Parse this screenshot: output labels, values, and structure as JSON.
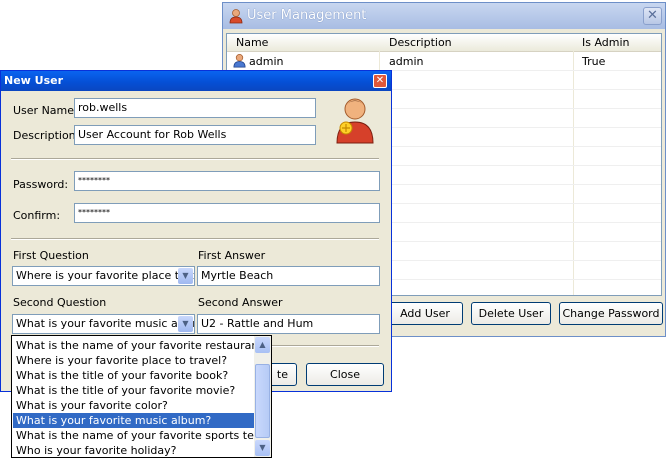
{
  "user_management": {
    "title": "User Management",
    "columns": [
      "Name",
      "Description",
      "Is Admin"
    ],
    "rows": [
      {
        "name": "admin",
        "description": "admin",
        "is_admin": "True"
      }
    ],
    "buttons": {
      "add_user": "Add User",
      "delete_user": "Delete User",
      "change_password": "Change Password"
    }
  },
  "new_user": {
    "title": "New User",
    "close_glyph": "✕",
    "user_name_label": "User Name:",
    "user_name_value": "rob.wells",
    "description_label": "Description:",
    "description_value": "User Account for Rob Wells",
    "password_label": "Password:",
    "password_value": "********",
    "confirm_label": "Confirm:",
    "confirm_value": "********",
    "first_question_label": "First Question",
    "first_question_value": "Where is your favorite place to tra",
    "first_answer_label": "First Answer",
    "first_answer_value": "Myrtle Beach",
    "second_question_label": "Second Question",
    "second_question_value": "What is your favorite music album",
    "second_answer_label": "Second Answer",
    "second_answer_value": "U2 - Rattle and Hum",
    "buttons": {
      "create_partial": "te",
      "close": "Close"
    }
  },
  "question_dropdown": {
    "options": [
      "What is the name of your favorite restaurant?",
      "Where is your favorite place to travel?",
      "What is the title of your favorite book?",
      "What is the title of your favorite movie?",
      "What is your favorite color?",
      "What is your favorite music album?",
      "What is the name of your favorite sports team?",
      "Who is your favorite holiday?"
    ],
    "selected_index": 5
  },
  "icons": {
    "app_icon": "user-icon",
    "user_avatar": "user-avatar-icon",
    "row_icon": "user-icon"
  },
  "colors": {
    "selection": "#316ac5",
    "titlebar_active": "#0550d6"
  }
}
